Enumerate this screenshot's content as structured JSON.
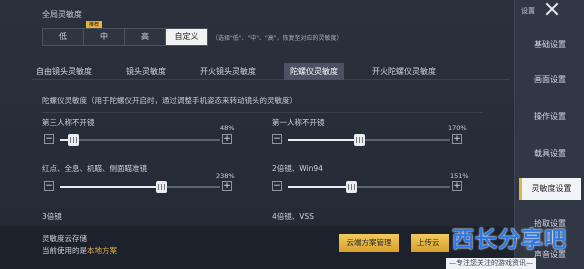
{
  "global": {
    "title": "全局灵敏度",
    "options": [
      "低",
      "中",
      "高",
      "自定义"
    ],
    "selected": "自定义",
    "recommended_badge": "推荐",
    "note": "（选择\"低\"、\"中\"、\"高\"，恢复至对应的灵敏度）"
  },
  "tabs": [
    "自由镜头灵敏度",
    "镜头灵敏度",
    "开火镜头灵敏度",
    "陀螺仪灵敏度",
    "开火陀螺仪灵敏度"
  ],
  "active_tab": "陀螺仪灵敏度",
  "description": "陀螺仪灵敏度（用于陀螺仪开启时，通过调整手机姿态来转动镜头的灵敏度）",
  "sliders": [
    {
      "label": "第三人称不开镜",
      "value": "48%",
      "level": 0.08
    },
    {
      "label": "第一人称不开镜",
      "value": "170%",
      "level": 0.44
    },
    {
      "label": "红点、全息、机瞄、侧面瞄准镜",
      "value": "238%",
      "level": 0.63
    },
    {
      "label": "2倍镜、Win94",
      "value": "151%",
      "level": 0.39
    }
  ],
  "next_labels": [
    "3倍镜",
    "4倍镜、VSS"
  ],
  "cloud": {
    "title": "灵敏度云存储",
    "current_prefix": "当前使用的是",
    "current_value": "本地方案",
    "manage_button": "云端方案管理",
    "upload_button": "上传云"
  },
  "watermark": {
    "title": "西长分享吧",
    "subtitle": "—专注您关注的游戏资讯—"
  },
  "sidebar": {
    "top_label": "设置",
    "items": [
      "基础设置",
      "画面设置",
      "操作设置",
      "载具设置",
      "灵敏度设置",
      "拾取设置",
      "声音设置"
    ],
    "active": "灵敏度设置"
  }
}
